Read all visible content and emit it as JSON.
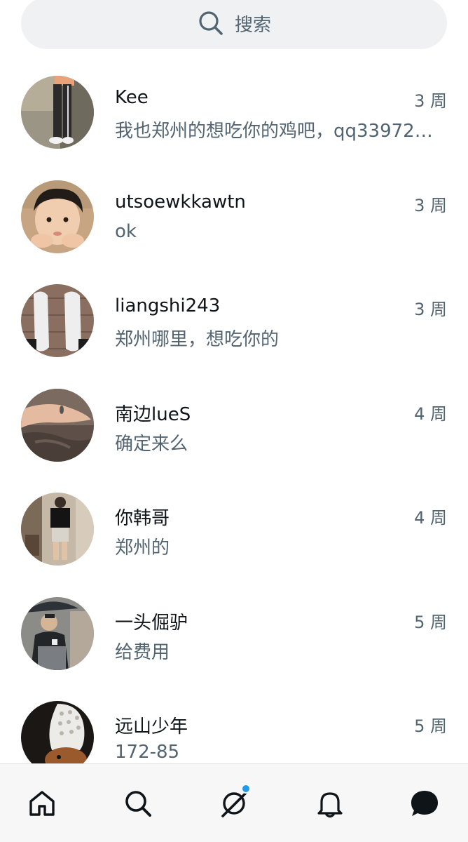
{
  "search": {
    "placeholder": "搜索",
    "icon": "search-icon"
  },
  "conversations": [
    {
      "name": "Kee",
      "time": "3 周",
      "preview": "我也郑州的想吃你的鸡吧，qq33972…",
      "avatar": "avatar-legs-photo"
    },
    {
      "name": "utsoewkkawtn",
      "time": "3 周",
      "preview": "ok",
      "avatar": "avatar-child-photo"
    },
    {
      "name": "liangshi243",
      "time": "3 周",
      "preview": "郑州哪里，想吃你的",
      "avatar": "avatar-sneakers-photo"
    },
    {
      "name": "南边lueS",
      "time": "4 周",
      "preview": "确定来么",
      "avatar": "avatar-hand-photo"
    },
    {
      "name": "你韩哥",
      "time": "4 周",
      "preview": "郑州的",
      "avatar": "avatar-mirror-selfie-photo"
    },
    {
      "name": "一头倔驴",
      "time": "5 周",
      "preview": "给费用",
      "avatar": "avatar-umbrella-photo"
    },
    {
      "name": "远山少年",
      "time": "5 周",
      "preview": "172-85",
      "avatar": "avatar-croc-shoe-photo"
    }
  ],
  "tabbar": {
    "items": [
      "home-icon",
      "search-icon",
      "grok-icon",
      "notifications-icon",
      "messages-icon"
    ],
    "active": "messages-icon",
    "badge_on": "grok-icon"
  },
  "colors": {
    "accent": "#1d9bf0",
    "secondary_text": "#536471",
    "primary_text": "#0f1419",
    "search_bg": "#eff1f3"
  }
}
